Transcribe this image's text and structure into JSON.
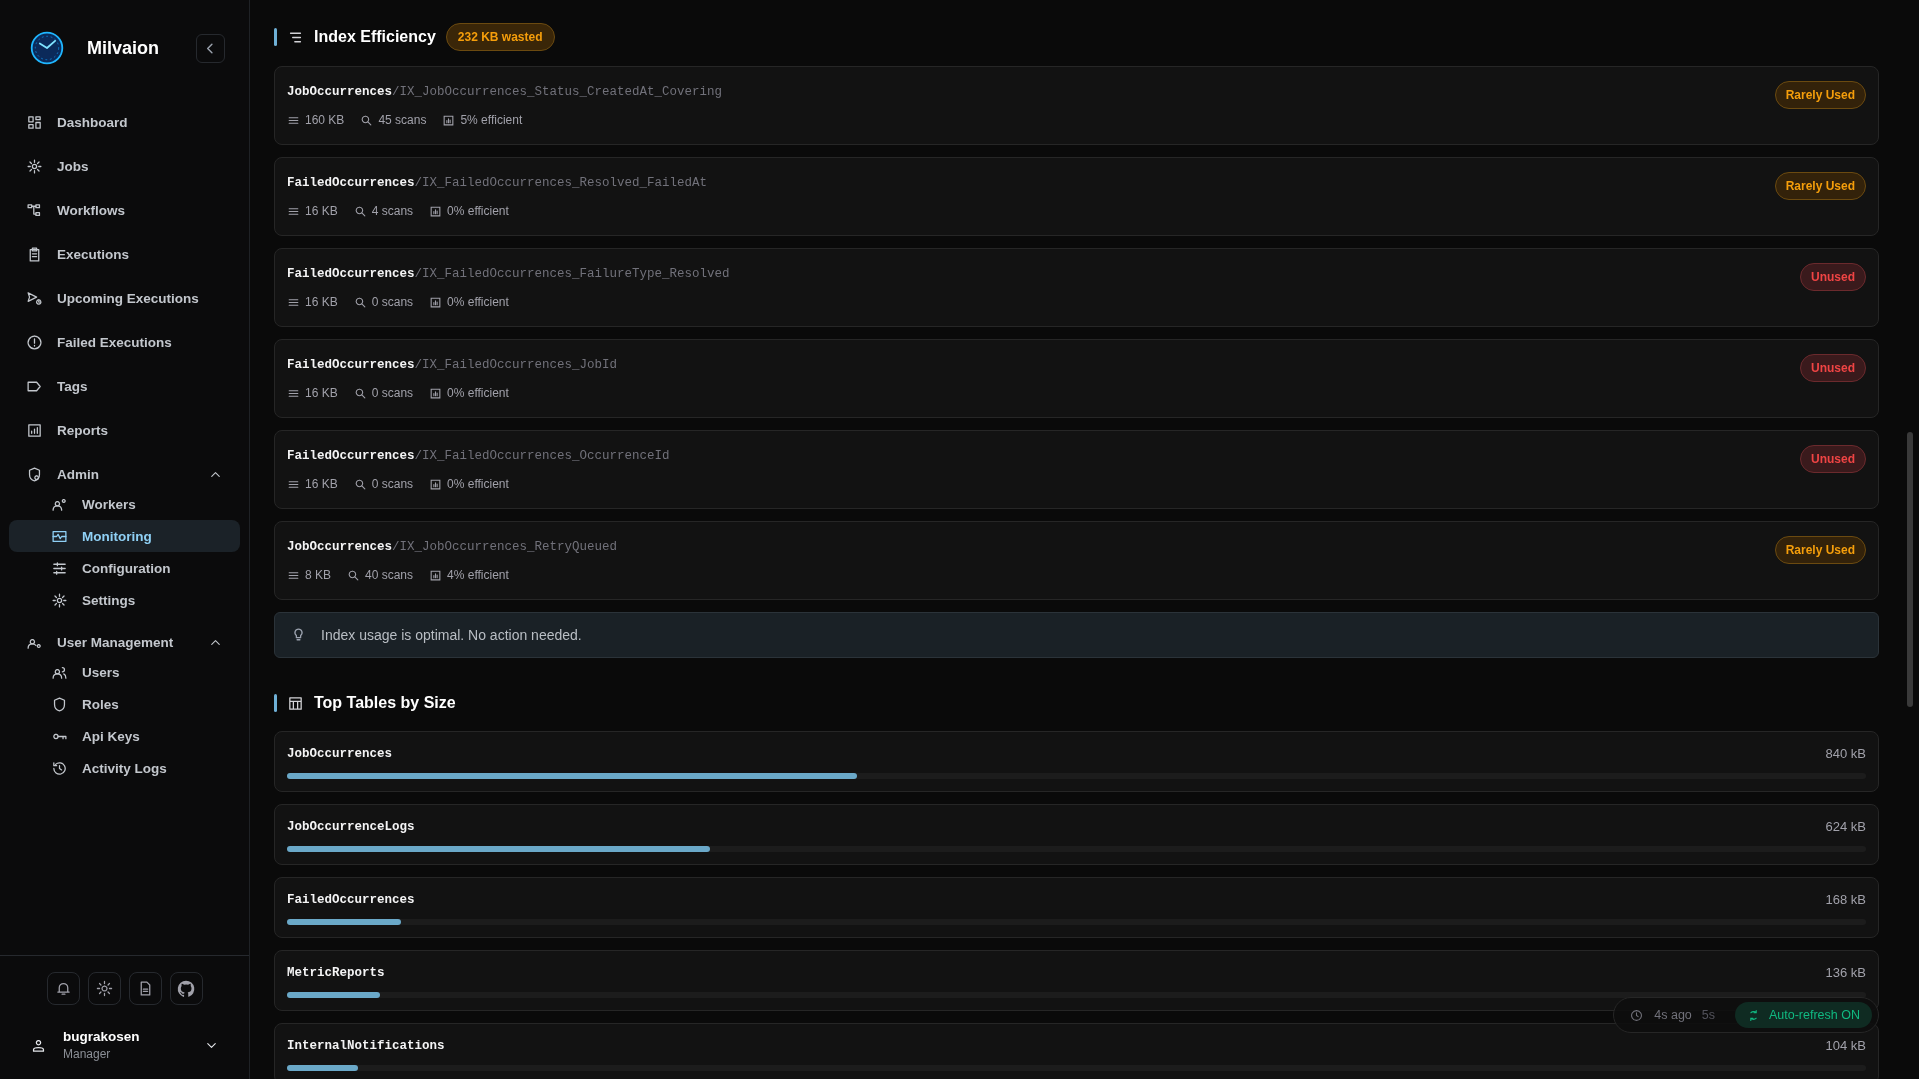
{
  "sidebar": {
    "brand": "Milvaion",
    "nav": [
      {
        "label": "Dashboard",
        "kind": "link",
        "selected": false
      },
      {
        "label": "Jobs",
        "kind": "link",
        "selected": false
      },
      {
        "label": "Workflows",
        "kind": "link",
        "selected": false
      },
      {
        "label": "Executions",
        "kind": "link",
        "selected": false
      },
      {
        "label": "Upcoming Executions",
        "kind": "link",
        "selected": false
      },
      {
        "label": "Failed Executions",
        "kind": "link",
        "selected": false
      },
      {
        "label": "Tags",
        "kind": "link",
        "selected": false
      },
      {
        "label": "Reports",
        "kind": "link",
        "selected": false
      },
      {
        "label": "Admin",
        "kind": "group",
        "expanded": true,
        "children": [
          {
            "label": "Workers",
            "selected": false
          },
          {
            "label": "Monitoring",
            "selected": true
          },
          {
            "label": "Configuration",
            "selected": false
          },
          {
            "label": "Settings",
            "selected": false
          }
        ]
      },
      {
        "label": "User Management",
        "kind": "group",
        "expanded": true,
        "children": [
          {
            "label": "Users",
            "selected": false
          },
          {
            "label": "Roles",
            "selected": false
          },
          {
            "label": "Api Keys",
            "selected": false
          },
          {
            "label": "Activity Logs",
            "selected": false
          }
        ]
      }
    ],
    "user": {
      "name": "bugrakosen",
      "role": "Manager"
    }
  },
  "index_efficiency": {
    "title": "Index Efficiency",
    "badge": "232 KB wasted",
    "indexes": [
      {
        "table": "JobOccurrences",
        "index": "/IX_JobOccurrences_Status_CreatedAt_Covering",
        "size": "160 KB",
        "scans": "45 scans",
        "efficiency": "5% efficient",
        "status": {
          "label": "Rarely Used",
          "kind": "warning"
        }
      },
      {
        "table": "FailedOccurrences",
        "index": "/IX_FailedOccurrences_Resolved_FailedAt",
        "size": "16 KB",
        "scans": "4 scans",
        "efficiency": "0% efficient",
        "status": {
          "label": "Rarely Used",
          "kind": "warning"
        }
      },
      {
        "table": "FailedOccurrences",
        "index": "/IX_FailedOccurrences_FailureType_Resolved",
        "size": "16 KB",
        "scans": "0 scans",
        "efficiency": "0% efficient",
        "status": {
          "label": "Unused",
          "kind": "danger"
        }
      },
      {
        "table": "FailedOccurrences",
        "index": "/IX_FailedOccurrences_JobId",
        "size": "16 KB",
        "scans": "0 scans",
        "efficiency": "0% efficient",
        "status": {
          "label": "Unused",
          "kind": "danger"
        }
      },
      {
        "table": "FailedOccurrences",
        "index": "/IX_FailedOccurrences_OccurrenceId",
        "size": "16 KB",
        "scans": "0 scans",
        "efficiency": "0% efficient",
        "status": {
          "label": "Unused",
          "kind": "danger"
        }
      },
      {
        "table": "JobOccurrences",
        "index": "/IX_JobOccurrences_RetryQueued",
        "size": "8 KB",
        "scans": "40 scans",
        "efficiency": "4% efficient",
        "status": {
          "label": "Rarely Used",
          "kind": "warning"
        }
      }
    ],
    "note": "Index usage is optimal. No action needed."
  },
  "top_tables": {
    "title": "Top Tables by Size",
    "tables": [
      {
        "name": "JobOccurrences",
        "size": "840 kB",
        "level": 0.361
      },
      {
        "name": "JobOccurrenceLogs",
        "size": "624 kB",
        "level": 0.268
      },
      {
        "name": "FailedOccurrences",
        "size": "168 kB",
        "level": 0.072
      },
      {
        "name": "MetricReports",
        "size": "136 kB",
        "level": 0.059
      },
      {
        "name": "InternalNotifications",
        "size": "104 kB",
        "level": 0.045
      }
    ]
  },
  "refresh_status": {
    "last_updated": "4s ago",
    "interval": "5s",
    "auto_refresh": {
      "label": "Auto-refresh ON",
      "on": true
    }
  }
}
